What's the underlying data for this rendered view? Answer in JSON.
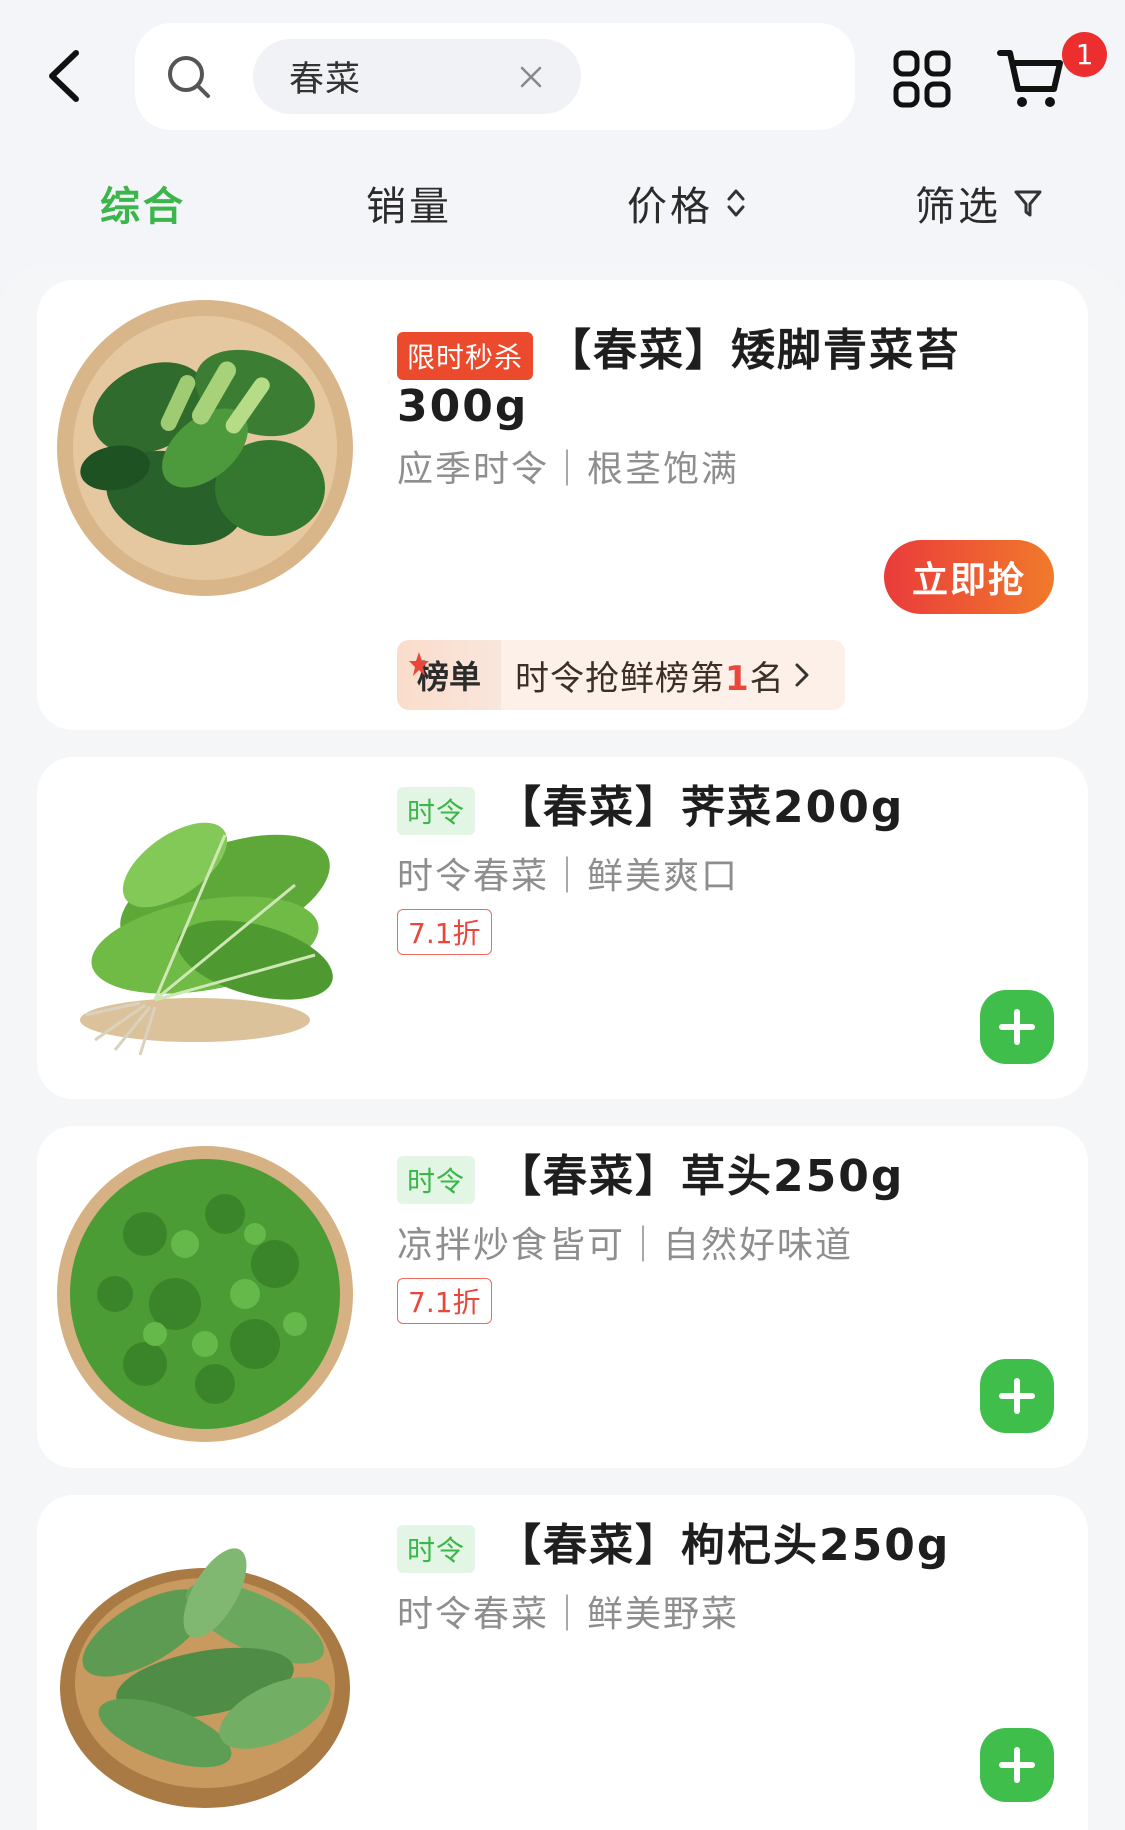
{
  "search": {
    "keyword": "春菜"
  },
  "cart": {
    "badge_count": "1"
  },
  "sort_tabs": {
    "comprehensive": "综合",
    "sales": "销量",
    "price": "价格",
    "filter": "筛选"
  },
  "products": [
    {
      "tag": "限时秒杀",
      "title_line1": "【春菜】矮脚青菜苔",
      "title_line2": "300g",
      "subtitle": "应季时令｜根茎饱满",
      "action_label": "立即抢",
      "rank_label": "榜单",
      "rank_text_prefix": "时令抢鲜榜第",
      "rank_number": "1",
      "rank_text_suffix": "名"
    },
    {
      "tag": "时令",
      "title": "【春菜】荠菜200g",
      "subtitle": "时令春菜｜鲜美爽口",
      "discount": "7.1折"
    },
    {
      "tag": "时令",
      "title": "【春菜】草头250g",
      "subtitle": "凉拌炒食皆可｜自然好味道",
      "discount": "7.1折"
    },
    {
      "tag": "时令",
      "title": "【春菜】枸杞头250g",
      "subtitle": "时令春菜｜鲜美野菜"
    }
  ],
  "colors": {
    "accent_green": "#3cb64a",
    "flash_red": "#ec4a2c",
    "badge_red": "#ec2e2e"
  }
}
